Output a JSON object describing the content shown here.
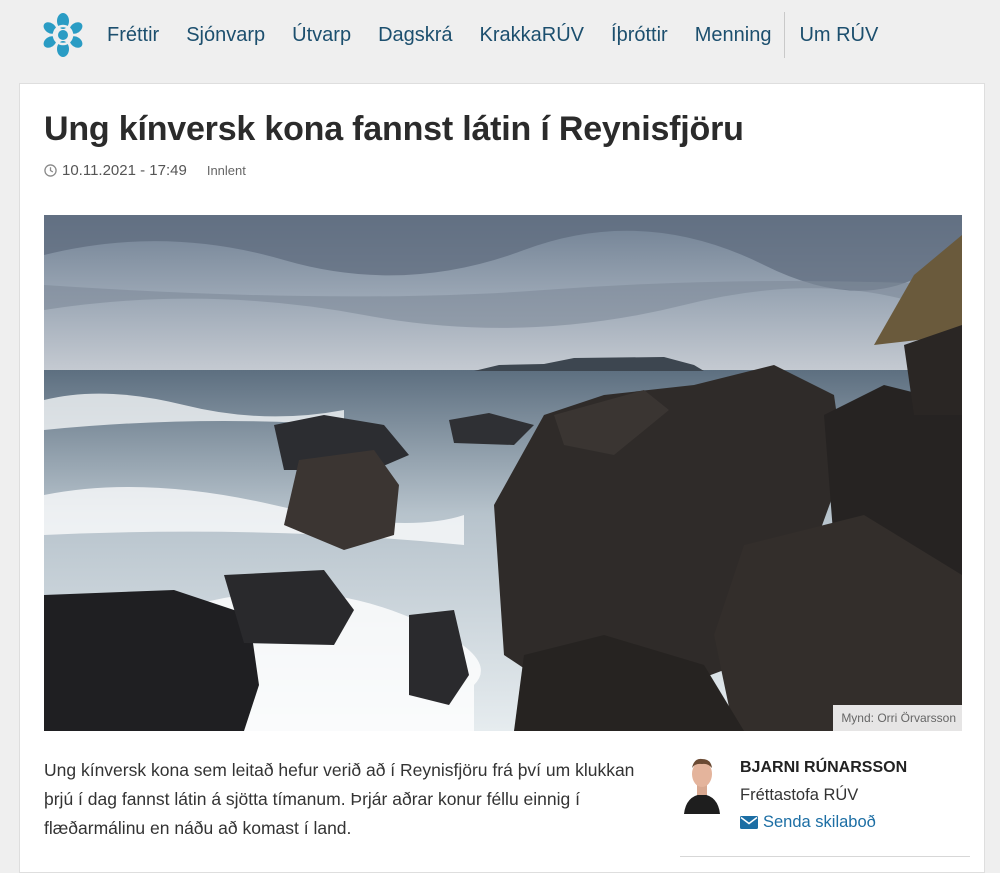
{
  "nav": {
    "items": [
      "Fréttir",
      "Sjónvarp",
      "Útvarp",
      "Dagskrá",
      "KrakkaRÚV",
      "Íþróttir",
      "Menning"
    ],
    "extra": "Um RÚV"
  },
  "article": {
    "title": "Ung kínversk kona fannst látin í Reynisfjöru",
    "date": "10.11.2021 - 17:49",
    "category": "Innlent",
    "photo_credit": "Mynd: Orri Örvarsson",
    "lead": "Ung kínversk kona sem leitað hefur verið að í Reynisfjöru frá því um klukkan þrjú í dag fannst látin á sjötta tímanum. Þrjár aðrar konur féllu einnig í flæðarmálinu en náðu að komast í land."
  },
  "author": {
    "name": "BJARNI RÚNARSSON",
    "org": "Fréttastofa RÚV",
    "send_label": "Senda skilaboð"
  },
  "colors": {
    "nav_text": "#1c4f6e",
    "logo": "#2a9cc4",
    "link": "#1c6ea4"
  },
  "icons": {
    "logo": "ruv-logo-icon",
    "clock": "clock-icon",
    "mail": "envelope-icon"
  }
}
